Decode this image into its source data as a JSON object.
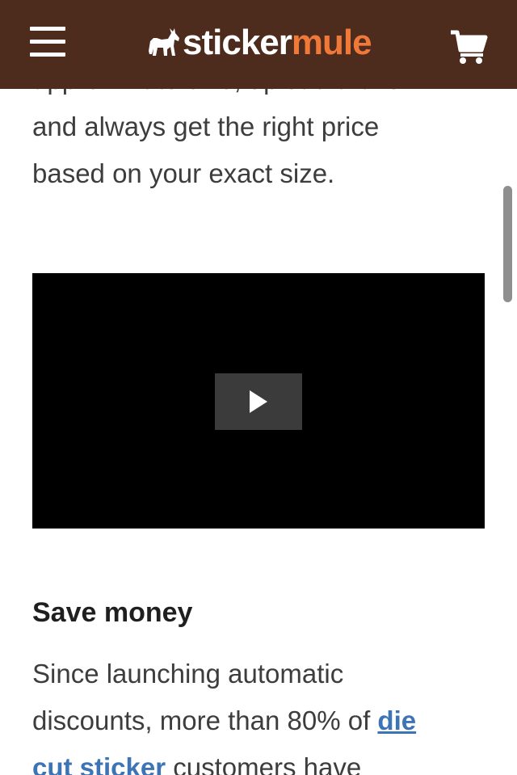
{
  "header": {
    "logo_part1": "sticker",
    "logo_part2": "mule",
    "colors": {
      "background": "#4d2c1e",
      "accent": "#f0793a"
    }
  },
  "intro": {
    "lines": [
      "approximate size, upload artwork",
      "and always get the right price",
      "based on your exact size."
    ]
  },
  "video": {
    "icon": "play-icon"
  },
  "save_money": {
    "title": "Save money",
    "line1": "Since launching automatic",
    "line2_prefix": "discounts, more than 80% of ",
    "link_part1": "die",
    "link_part2": "cut sticker",
    "line3_suffix": " customers have"
  },
  "colors": {
    "link": "#3d74b5",
    "text": "#3d3d3d"
  }
}
